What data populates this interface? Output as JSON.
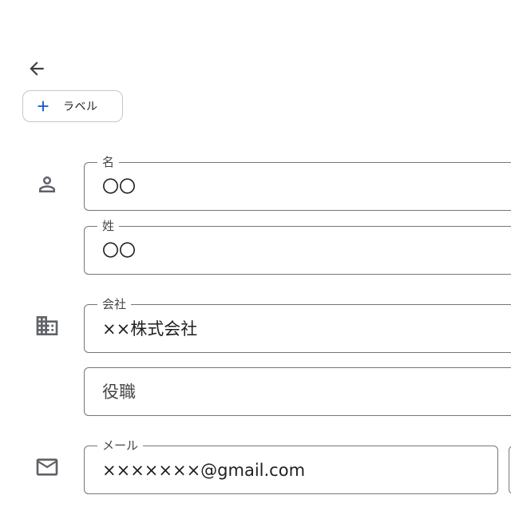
{
  "header": {
    "back_icon": "arrow-back-icon"
  },
  "label_button": {
    "icon": "plus-icon",
    "label": "ラベル",
    "accent": "#0b57d0"
  },
  "name_section": {
    "icon": "person-icon",
    "first_name": {
      "label": "名",
      "value": "〇〇"
    },
    "last_name": {
      "label": "姓",
      "value": "〇〇"
    }
  },
  "company_section": {
    "icon": "building-icon",
    "company": {
      "label": "会社",
      "value": "××株式会社"
    },
    "job_title": {
      "placeholder": "役職"
    }
  },
  "email_section": {
    "icon": "mail-icon",
    "email": {
      "label": "メール",
      "value": "×××××××@gmail.com"
    }
  }
}
